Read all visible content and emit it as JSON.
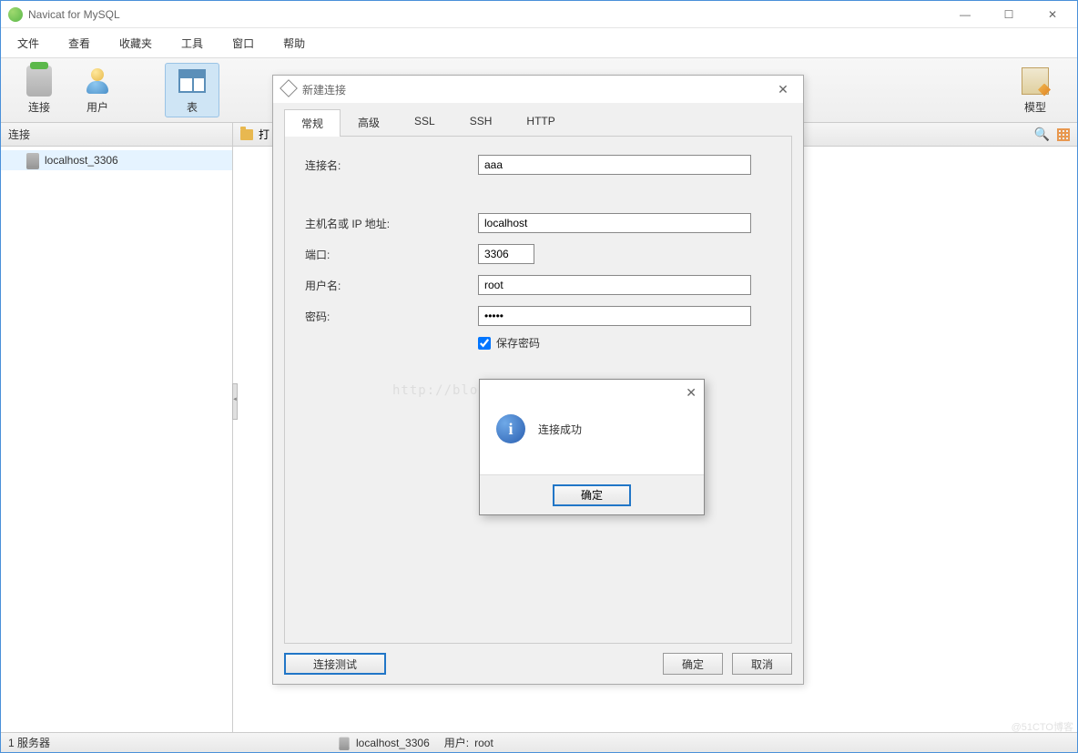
{
  "window": {
    "title": "Navicat for MySQL",
    "controls": {
      "min": "—",
      "max": "☐",
      "close": "✕"
    }
  },
  "menu": {
    "items": [
      "文件",
      "查看",
      "收藏夹",
      "工具",
      "窗口",
      "帮助"
    ]
  },
  "toolbar": {
    "connect": "连接",
    "user": "用户",
    "table": "表",
    "model": "模型"
  },
  "sidebar": {
    "header": "连接",
    "items": [
      {
        "label": "localhost_3306"
      }
    ]
  },
  "content": {
    "open_label": "打"
  },
  "dialog": {
    "title": "新建连接",
    "tabs": [
      "常规",
      "高级",
      "SSL",
      "SSH",
      "HTTP"
    ],
    "active_tab": 0,
    "fields": {
      "conn_name": {
        "label": "连接名:",
        "value": "aaa"
      },
      "host": {
        "label": "主机名或 IP 地址:",
        "value": "localhost"
      },
      "port": {
        "label": "端口:",
        "value": "3306"
      },
      "user": {
        "label": "用户名:",
        "value": "root"
      },
      "password": {
        "label": "密码:",
        "value": "•••••"
      },
      "save_pw": {
        "label": "保存密码",
        "checked": true
      }
    },
    "buttons": {
      "test": "连接测试",
      "ok": "确定",
      "cancel": "取消"
    }
  },
  "msgbox": {
    "text": "连接成功",
    "ok": "确定"
  },
  "status": {
    "servers": "1 服务器",
    "conn": "localhost_3306",
    "user_label": "用户:",
    "user_value": "root"
  },
  "watermark": "http://blog.csdn.net/wyxeainn",
  "corner_wm": "@51CTO博客"
}
